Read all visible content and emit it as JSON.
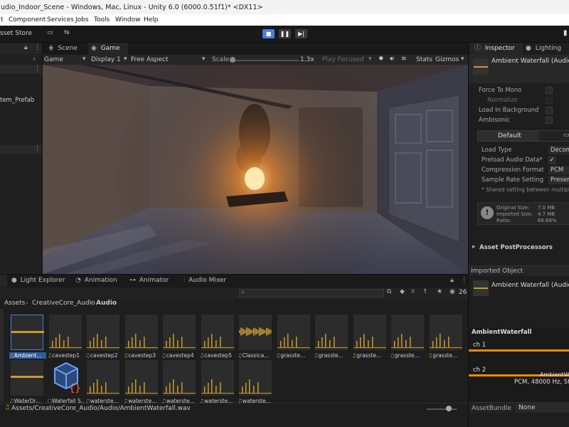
{
  "window": {
    "title": "udio_Indoor_Scene - Windows, Mac, Linux - Unity 6.0 (6000.0.51f1)* <DX11>"
  },
  "menu": {
    "items": [
      "t",
      "Component",
      "Services",
      "Jobs",
      "Tools",
      "Window",
      "Help"
    ]
  },
  "toolbar": {
    "asset_store_label": "sset Store"
  },
  "hierarchy": {
    "partial_label": "tem_Prefab"
  },
  "scene_tabs": {
    "scene": "Scene",
    "game": "Game"
  },
  "game_bar": {
    "mode": "Game",
    "display": "Display 1",
    "aspect": "Free Aspect",
    "scale_label": "Scale",
    "scale_value": "1.3x",
    "play_focused": "Play Focused",
    "stats": "Stats",
    "gizmos": "Gizmos"
  },
  "bottom_tabs": {
    "light_explorer": "Light Explorer",
    "animation": "Animation",
    "animator": "Animator",
    "audio_mixer": "Audio Mixer"
  },
  "project": {
    "breadcrumb": [
      "Assets",
      "CreativeCore_Audio",
      "Audio"
    ],
    "item_count": "26",
    "row1": [
      "Ambient...",
      "cavestep1",
      "cavestep2",
      "cavestep3",
      "cavestep4",
      "cavestep5",
      "Classica...",
      "grasste...",
      "grasste...",
      "grasste...",
      "grasste...",
      "grasste..."
    ],
    "row2": [
      "WaterDr...",
      "Waterfall S...",
      "waterste...",
      "waterste...",
      "waterste...",
      "waterste...",
      "waterste..."
    ],
    "status_path": "Assets/CreativeCore_Audio/Audio/AmbientWaterfall.wav"
  },
  "inspector": {
    "tab_inspector": "Inspector",
    "tab_lighting": "Lighting",
    "asset_title": "Ambient Waterfall (Audio",
    "force_to_mono": "Force To Mono",
    "normalize": "Normalize",
    "load_in_background": "Load In Background",
    "ambisonic": "Ambisonic",
    "platform_default": "Default",
    "load_type_label": "Load Type",
    "load_type_value": "Decom",
    "preload_label": "Preload Audio Data*",
    "compression_label": "Compression Format",
    "compression_value": "PCM",
    "sample_rate_label": "Sample Rate Setting",
    "sample_rate_value": "Preser",
    "shared_note": "* Shared setting between multiple pla",
    "original_size_label": "Original Size:",
    "original_size": "7.0 MB",
    "imported_size_label": "Imported Size:",
    "imported_size": "4.7 MB",
    "ratio_label": "Ratio:",
    "ratio": "66.66%",
    "postprocessors": "Asset PostProcessors",
    "imported_object": "Imported Object",
    "imported_title": "Ambient Waterfall (Audio",
    "preview_name": "AmbientWaterfall",
    "ch1": "ch 1",
    "ch2": "ch 2",
    "overlay_name": "AmbientW",
    "format_info": "PCM, 48000 Hz, St",
    "asset_bundle_label": "AssetBundle",
    "asset_bundle_value": "None"
  },
  "colors": {
    "accent": "#4a7fd6",
    "waveform": "#c89a2a",
    "audio_wave": "#f08a00"
  }
}
